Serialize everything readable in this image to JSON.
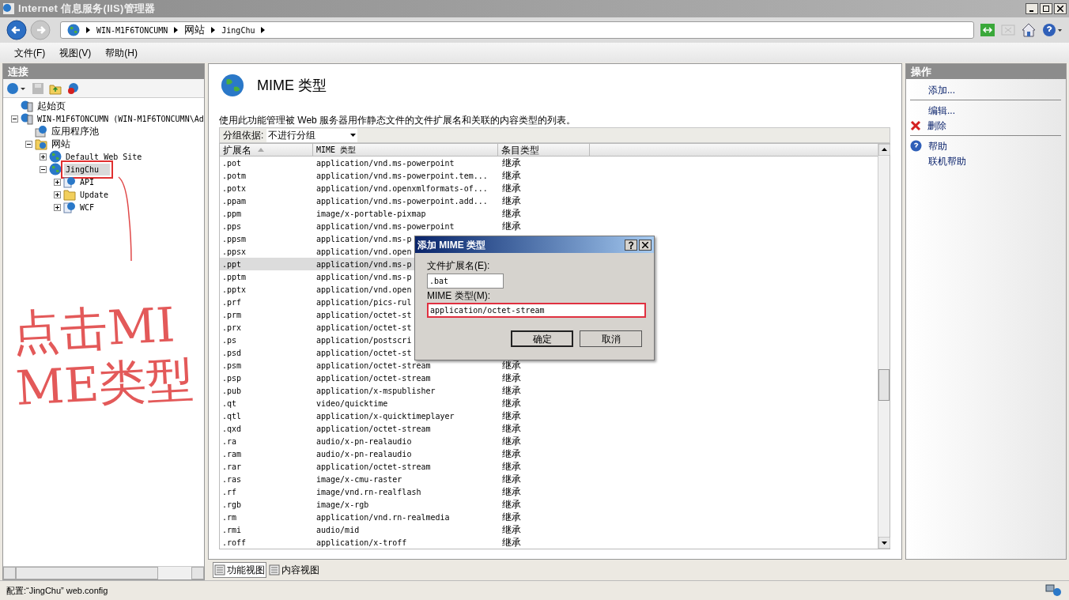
{
  "window": {
    "title": "Internet 信息服务(IIS)管理器"
  },
  "address": {
    "crumbs": [
      "WIN-M1F6TONCUMN",
      "网站",
      "JingChu"
    ]
  },
  "menu": [
    "文件(F)",
    "视图(V)",
    "帮助(H)"
  ],
  "connections": {
    "title": "连接",
    "tree": [
      {
        "label": "起始页",
        "kind": "start",
        "selected": false
      },
      {
        "label": "WIN-M1F6TONCUMN (WIN-M1F6TONCUMN\\Ad",
        "kind": "server",
        "expandable": true,
        "expanded": true,
        "selected": false,
        "children": [
          {
            "label": "应用程序池",
            "kind": "pool",
            "selected": false
          },
          {
            "label": "网站",
            "kind": "sites",
            "expandable": true,
            "expanded": true,
            "selected": false,
            "children": [
              {
                "label": "Default Web Site",
                "kind": "site",
                "expandable": true,
                "expanded": false,
                "selected": false
              },
              {
                "label": "JingChu",
                "kind": "site",
                "expandable": true,
                "expanded": true,
                "selected": true,
                "highlighted": true,
                "children": [
                  {
                    "label": "API",
                    "kind": "app",
                    "expandable": true,
                    "expanded": false,
                    "selected": false
                  },
                  {
                    "label": "Update",
                    "kind": "folder",
                    "expandable": true,
                    "expanded": false,
                    "selected": false
                  },
                  {
                    "label": "WCF",
                    "kind": "app",
                    "expandable": true,
                    "expanded": false,
                    "selected": false
                  }
                ]
              }
            ]
          }
        ]
      }
    ]
  },
  "feature": {
    "title": "MIME 类型",
    "description": "使用此功能管理被 Web 服务器用作静态文件的文件扩展名和关联的内容类型的列表。",
    "group_label": "分组依据:",
    "group_value": "不进行分组",
    "table": {
      "columns": [
        "扩展名",
        "MIME 类型",
        "条目类型"
      ],
      "rows": [
        {
          "ext": ".pot",
          "mime": "application/vnd.ms-powerpoint",
          "type": "继承",
          "selected": false
        },
        {
          "ext": ".potm",
          "mime": "application/vnd.ms-powerpoint.tem...",
          "type": "继承",
          "selected": false
        },
        {
          "ext": ".potx",
          "mime": "application/vnd.openxmlformats-of...",
          "type": "继承",
          "selected": false
        },
        {
          "ext": ".ppam",
          "mime": "application/vnd.ms-powerpoint.add...",
          "type": "继承",
          "selected": false
        },
        {
          "ext": ".ppm",
          "mime": "image/x-portable-pixmap",
          "type": "继承",
          "selected": false
        },
        {
          "ext": ".pps",
          "mime": "application/vnd.ms-powerpoint",
          "type": "继承",
          "selected": false
        },
        {
          "ext": ".ppsm",
          "mime": "application/vnd.ms-p",
          "selected": false
        },
        {
          "ext": ".ppsx",
          "mime": "application/vnd.open",
          "selected": false
        },
        {
          "ext": ".ppt",
          "mime": "application/vnd.ms-p",
          "selected": true
        },
        {
          "ext": ".pptm",
          "mime": "application/vnd.ms-p",
          "selected": false
        },
        {
          "ext": ".pptx",
          "mime": "application/vnd.open",
          "selected": false
        },
        {
          "ext": ".prf",
          "mime": "application/pics-rul",
          "selected": false
        },
        {
          "ext": ".prm",
          "mime": "application/octet-st",
          "selected": false
        },
        {
          "ext": ".prx",
          "mime": "application/octet-st",
          "selected": false
        },
        {
          "ext": ".ps",
          "mime": "application/postscri",
          "selected": false
        },
        {
          "ext": ".psd",
          "mime": "application/octet-st",
          "selected": false
        },
        {
          "ext": ".psm",
          "mime": "application/octet-stream",
          "type": "继承",
          "selected": false
        },
        {
          "ext": ".psp",
          "mime": "application/octet-stream",
          "type": "继承",
          "selected": false
        },
        {
          "ext": ".pub",
          "mime": "application/x-mspublisher",
          "type": "继承",
          "selected": false
        },
        {
          "ext": ".qt",
          "mime": "video/quicktime",
          "type": "继承",
          "selected": false
        },
        {
          "ext": ".qtl",
          "mime": "application/x-quicktimeplayer",
          "type": "继承",
          "selected": false
        },
        {
          "ext": ".qxd",
          "mime": "application/octet-stream",
          "type": "继承",
          "selected": false
        },
        {
          "ext": ".ra",
          "mime": "audio/x-pn-realaudio",
          "type": "继承",
          "selected": false
        },
        {
          "ext": ".ram",
          "mime": "audio/x-pn-realaudio",
          "type": "继承",
          "selected": false
        },
        {
          "ext": ".rar",
          "mime": "application/octet-stream",
          "type": "继承",
          "selected": false
        },
        {
          "ext": ".ras",
          "mime": "image/x-cmu-raster",
          "type": "继承",
          "selected": false
        },
        {
          "ext": ".rf",
          "mime": "image/vnd.rn-realflash",
          "type": "继承",
          "selected": false
        },
        {
          "ext": ".rgb",
          "mime": "image/x-rgb",
          "type": "继承",
          "selected": false
        },
        {
          "ext": ".rm",
          "mime": "application/vnd.rn-realmedia",
          "type": "继承",
          "selected": false
        },
        {
          "ext": ".rmi",
          "mime": "audio/mid",
          "type": "继承",
          "selected": false
        },
        {
          "ext": ".roff",
          "mime": "application/x-troff",
          "type": "继承",
          "selected": false
        }
      ]
    },
    "view_tabs": [
      {
        "label": "功能视图",
        "selected": true
      },
      {
        "label": "内容视图",
        "selected": false
      }
    ]
  },
  "actions": {
    "title": "操作",
    "items": [
      {
        "label": "添加...",
        "kind": "plain"
      },
      {
        "kind": "divider"
      },
      {
        "label": "编辑...",
        "kind": "plain"
      },
      {
        "label": "删除",
        "kind": "delete"
      },
      {
        "kind": "divider"
      },
      {
        "label": "帮助",
        "kind": "help"
      },
      {
        "label": "联机帮助",
        "kind": "plain"
      }
    ]
  },
  "dialog": {
    "title": "添加 MIME 类型",
    "ext_label": "文件扩展名(E):",
    "ext_value": ".bat",
    "mime_label": "MIME 类型(M):",
    "mime_value": "application/octet-stream",
    "mime_highlighted": true,
    "buttons": [
      "确定",
      "取消"
    ]
  },
  "annotation": {
    "text": "点击MIME类型"
  },
  "status_bar": {
    "text": "配置:“JingChu” web.config"
  }
}
